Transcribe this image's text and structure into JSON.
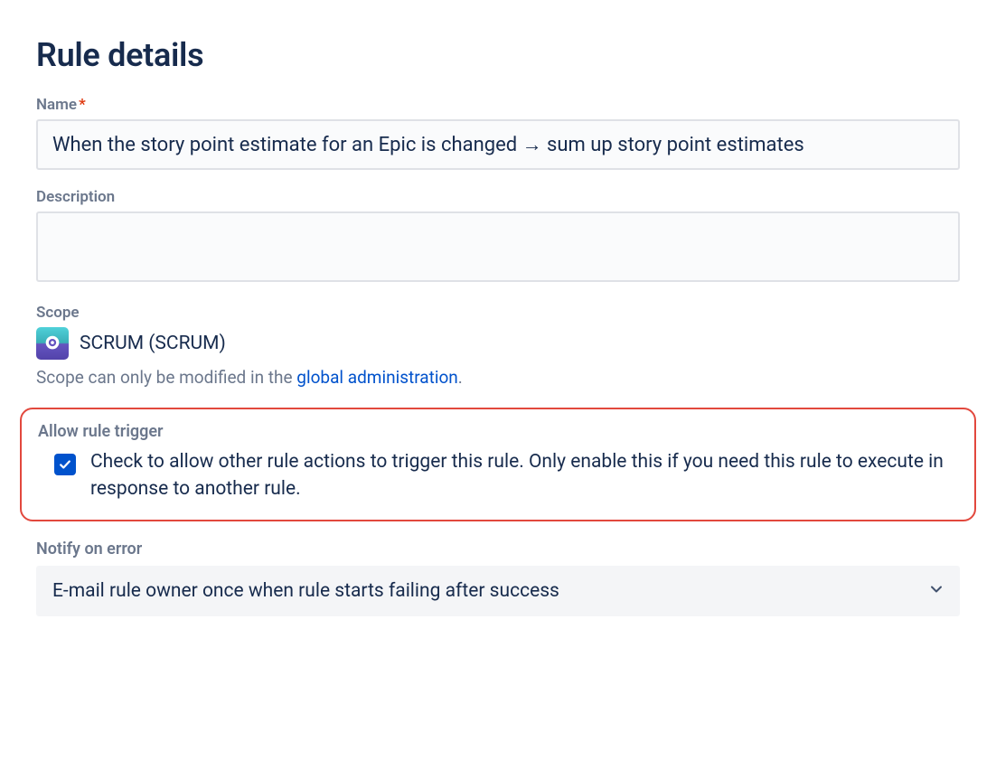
{
  "page": {
    "title": "Rule details"
  },
  "fields": {
    "name": {
      "label": "Name",
      "required_mark": "*",
      "value": "When the story point estimate for an Epic is changed → sum up story point estimates"
    },
    "description": {
      "label": "Description",
      "value": ""
    },
    "scope": {
      "label": "Scope",
      "project_name": "SCRUM (SCRUM)",
      "hint_prefix": "Scope can only be modified in the ",
      "hint_link": "global administration",
      "hint_suffix": "."
    },
    "allow_rule_trigger": {
      "label": "Allow rule trigger",
      "checked": true,
      "description": "Check to allow other rule actions to trigger this rule. Only enable this if you need this rule to execute in response to another rule."
    },
    "notify_on_error": {
      "label": "Notify on error",
      "selected": "E-mail rule owner once when rule starts failing after success"
    }
  }
}
